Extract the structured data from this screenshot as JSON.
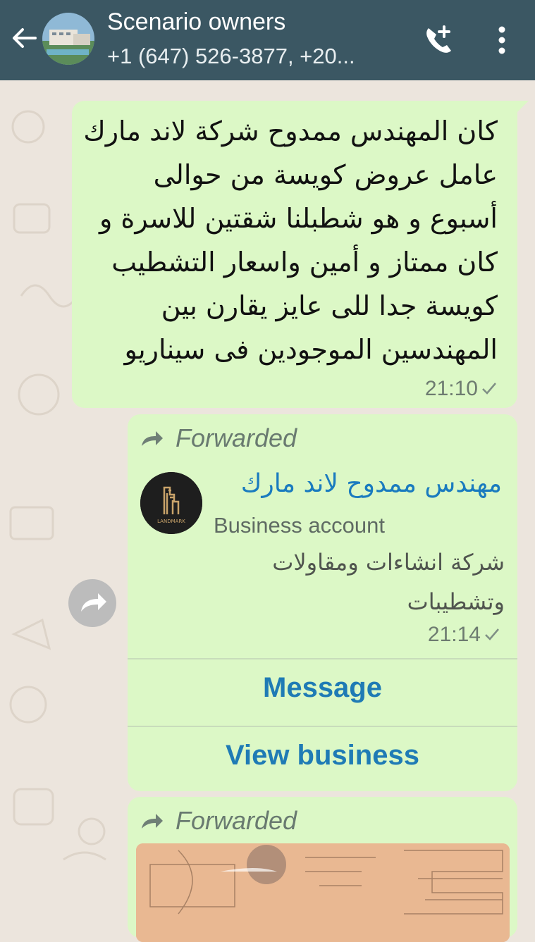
{
  "header": {
    "title": "Scenario owners",
    "subtitle": "+1 (647) 526-3877, +20..."
  },
  "message1": {
    "lines": [
      "كان المهندس ممدوح شركة لاند مارك",
      "عامل عروض  كويسة من حوالى",
      "أسبوع و هو شطبلنا شقتين للاسرة و",
      "كان ممتاز و أمين واسعار التشطيب",
      "كويسة جدا للى عايز يقارن بين",
      "المهندسين الموجودين فى سيناريو"
    ],
    "time": "21:10"
  },
  "contact_card": {
    "forwarded_label": "Forwarded",
    "name": "مهندس ممدوح  لاند مارك",
    "type": "Business account",
    "description": "شركة انشاءات ومقاولات وتشطيبات",
    "time": "21:14",
    "logo_text": "LANDMARK",
    "message_button": "Message",
    "view_button": "View business"
  },
  "image_message": {
    "forwarded_label": "Forwarded"
  },
  "colors": {
    "header_bg": "#3b5763",
    "bubble_bg": "#dcf8c6",
    "link_blue": "#1f7bb5",
    "chat_bg": "#ece5dd"
  }
}
